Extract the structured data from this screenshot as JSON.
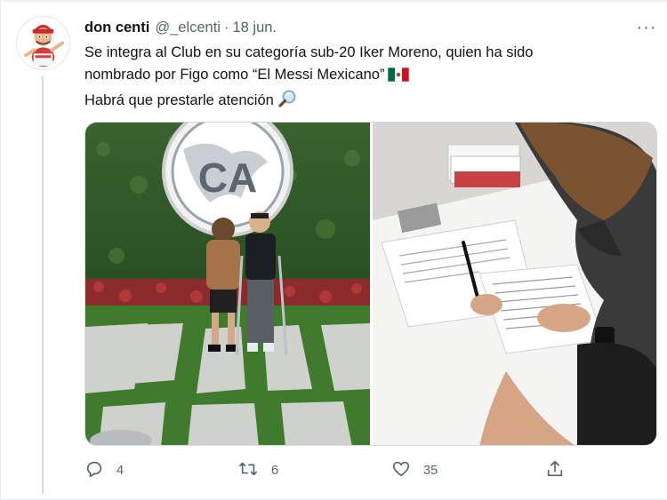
{
  "tweet": {
    "author_name": "don centi",
    "author_handle": "@_elcenti",
    "separator": "·",
    "date": "18 jun.",
    "more_label": "···",
    "text_line1": "Se integra al Club en su categoría sub-20 Iker Moreno, quien ha sido",
    "text_line2": "nombrado por Figo como “El Messi Mexicano”",
    "text_line3": "Habrá que prestarle atención",
    "emoji_line2": "mexico-flag-icon",
    "emoji_line3": "magnifying-glass-icon"
  },
  "media": {
    "left_photo": "club-america-crest-two-players-photo",
    "right_photo": "contract-signing-photo",
    "crest_text": "CA"
  },
  "actions": {
    "reply_count": "4",
    "retweet_count": "6",
    "like_count": "35",
    "reply_icon": "reply-icon",
    "retweet_icon": "retweet-icon",
    "like_icon": "heart-icon",
    "share_icon": "share-icon"
  },
  "colors": {
    "text": "#0f1419",
    "secondary": "#536471",
    "border": "#cfd9de"
  }
}
